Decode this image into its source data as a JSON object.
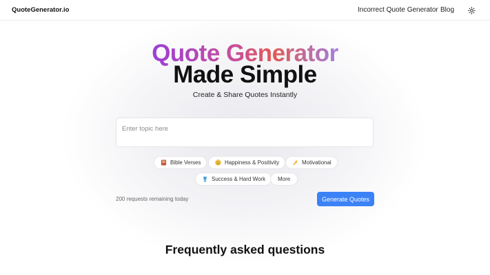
{
  "header": {
    "logo": "QuoteGenerator.io",
    "nav": [
      {
        "label": "Incorrect Quote Generator"
      },
      {
        "label": "Blog"
      }
    ],
    "theme_toggle_icon": "sun-icon"
  },
  "hero": {
    "line1": "Quote Generator",
    "line2": "Made Simple",
    "subtitle": "Create & Share Quotes Instantly",
    "gradient_colors": [
      "#9b3fd6",
      "#c94f9a",
      "#e25a55",
      "#a07ee0"
    ]
  },
  "input": {
    "placeholder": "Enter topic here",
    "value": ""
  },
  "chips": [
    {
      "label": "Bible Verses",
      "icon": "book-icon"
    },
    {
      "label": "Happiness & Positivity",
      "icon": "smiley-icon"
    },
    {
      "label": "Motivational",
      "icon": "flexed-arm-icon"
    },
    {
      "label": "Success & Hard Work",
      "icon": "trophy-icon"
    },
    {
      "label": "More",
      "icon": ""
    }
  ],
  "status": {
    "remaining": "200 requests remaining today"
  },
  "generate": {
    "label": "Generate Quotes",
    "color": "#3b82f6"
  },
  "faq": {
    "title": "Frequently asked questions"
  }
}
